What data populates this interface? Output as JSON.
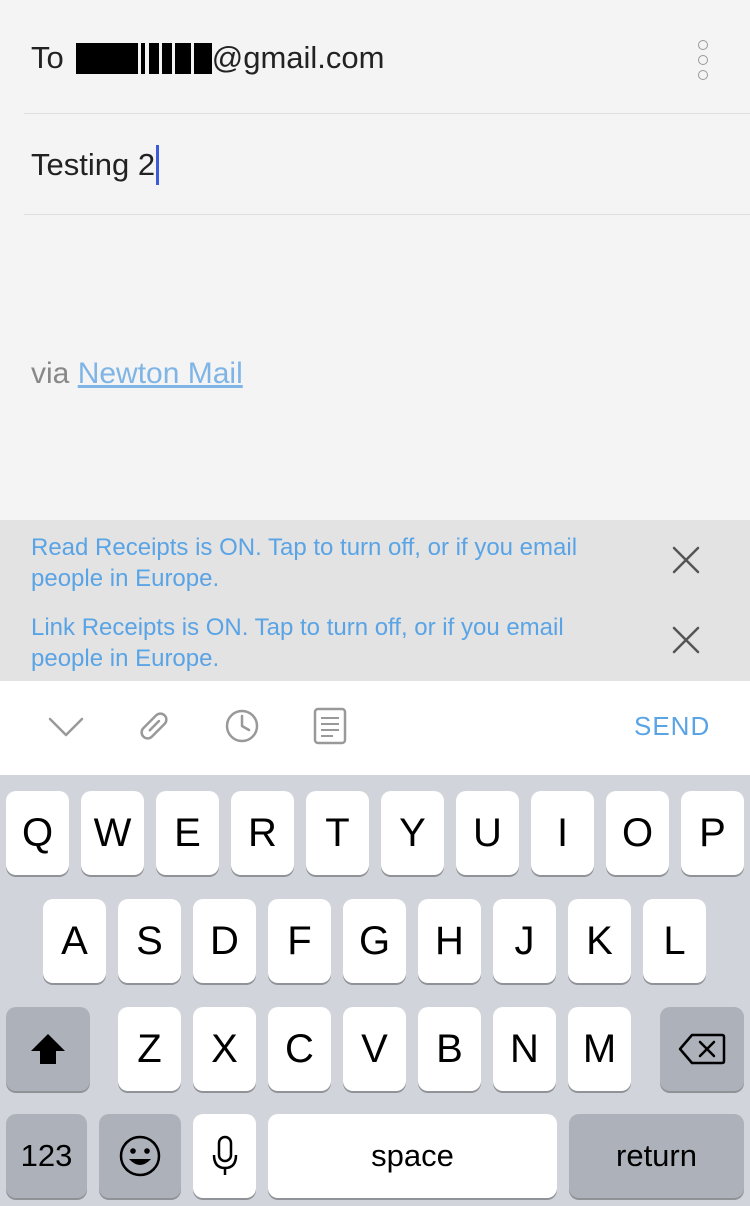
{
  "compose": {
    "to_label": "To",
    "to_address_suffix": "@gmail.com",
    "subject_value": "Testing 2",
    "signature_prefix": "via",
    "signature_link": "Newton Mail"
  },
  "banners": [
    {
      "text": "Read Receipts is ON. Tap to turn off, or if you email people in Europe."
    },
    {
      "text": "Link Receipts is ON. Tap to turn off, or if you email people in Europe."
    }
  ],
  "toolbar": {
    "icons": [
      "chevron-down-icon",
      "paperclip-icon",
      "clock-icon",
      "template-icon"
    ],
    "send_label": "SEND"
  },
  "keyboard": {
    "row1": [
      "Q",
      "W",
      "E",
      "R",
      "T",
      "Y",
      "U",
      "I",
      "O",
      "P"
    ],
    "row2": [
      "A",
      "S",
      "D",
      "F",
      "G",
      "H",
      "J",
      "K",
      "L"
    ],
    "row3": [
      "Z",
      "X",
      "C",
      "V",
      "B",
      "N",
      "M"
    ],
    "numbers_label": "123",
    "space_label": "space",
    "return_label": "return"
  },
  "colors": {
    "accent": "#5aa4e6",
    "caret": "#3b5bdb",
    "keyboard_bg": "#d1d4da",
    "banner_bg": "#e3e3e3"
  }
}
